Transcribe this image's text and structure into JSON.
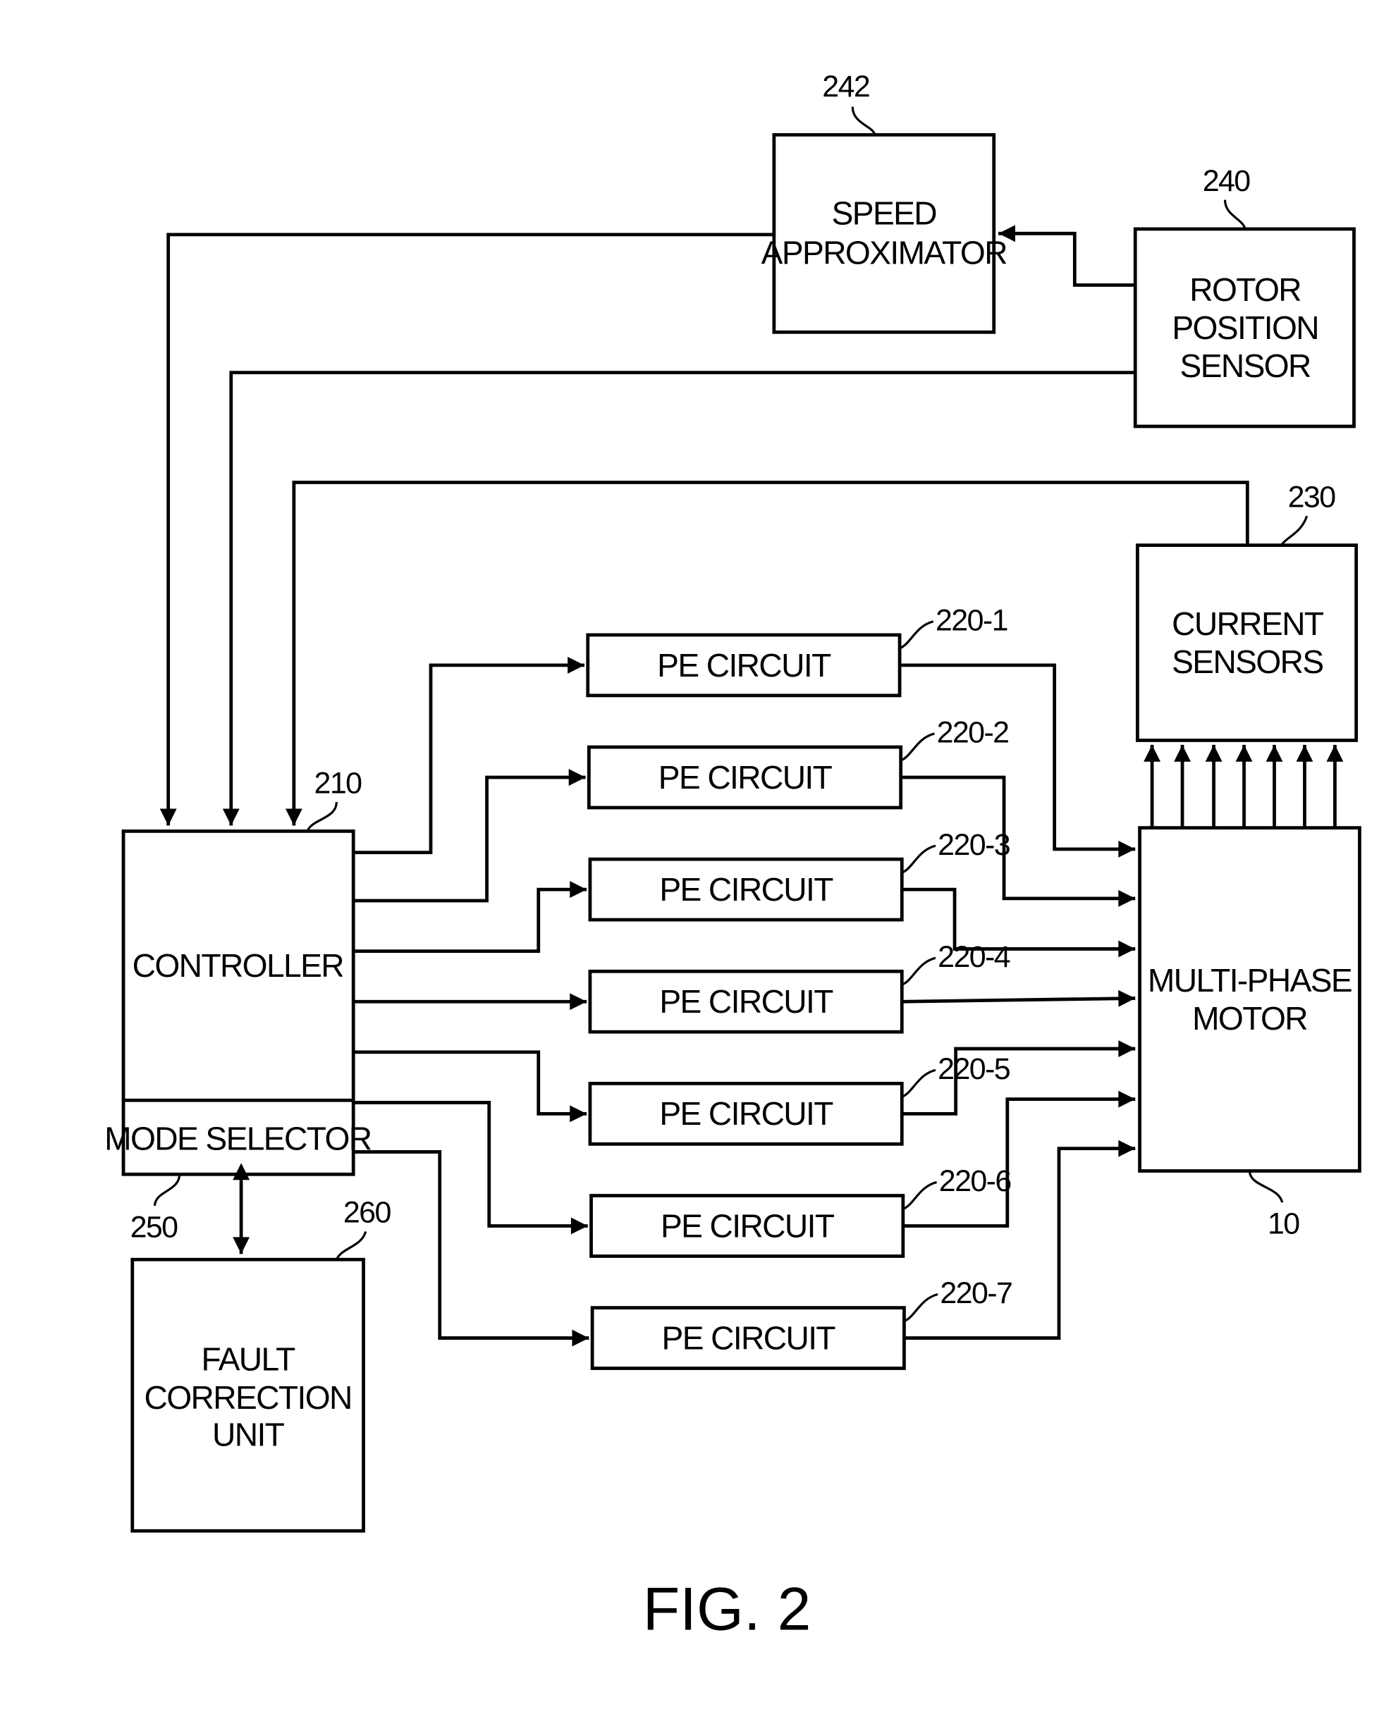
{
  "figure_label": "FIG. 2",
  "blocks": {
    "speed_approximator": {
      "lines": [
        "SPEED",
        "APPROXIMATOR"
      ],
      "ref": "242"
    },
    "rotor_position_sensor": {
      "lines": [
        "ROTOR",
        "POSITION",
        "SENSOR"
      ],
      "ref": "240"
    },
    "current_sensors": {
      "lines": [
        "CURRENT",
        "SENSORS"
      ],
      "ref": "230"
    },
    "controller": {
      "lines": [
        "CONTROLLER"
      ],
      "ref": "210"
    },
    "mode_selector": {
      "lines": [
        "MODE SELECTOR"
      ],
      "ref": "250"
    },
    "fault_correction_unit": {
      "lines": [
        "FAULT",
        "CORRECTION",
        "UNIT"
      ],
      "ref": "260"
    },
    "multi_phase_motor": {
      "lines": [
        "MULTI-PHASE",
        "MOTOR"
      ],
      "ref": "10"
    }
  },
  "pe_circuits": [
    {
      "label": "PE CIRCUIT",
      "ref": "220-1"
    },
    {
      "label": "PE CIRCUIT",
      "ref": "220-2"
    },
    {
      "label": "PE CIRCUIT",
      "ref": "220-3"
    },
    {
      "label": "PE CIRCUIT",
      "ref": "220-4"
    },
    {
      "label": "PE CIRCUIT",
      "ref": "220-5"
    },
    {
      "label": "PE CIRCUIT",
      "ref": "220-6"
    },
    {
      "label": "PE CIRCUIT",
      "ref": "220-7"
    }
  ]
}
